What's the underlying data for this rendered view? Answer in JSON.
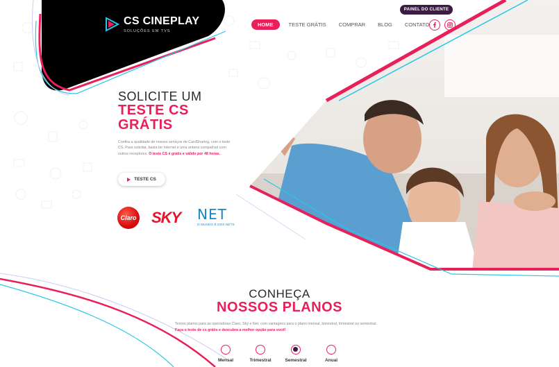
{
  "brand": {
    "name": "CS CINEPLAY",
    "tagline": "SOLUÇÕES EM TVS"
  },
  "header": {
    "client_button": "PAINEL DO CLIENTE",
    "nav": [
      "HOME",
      "TESTE GRÁTIS",
      "COMPRAR",
      "BLOG",
      "CONTATO"
    ],
    "active_nav": "HOME",
    "social": [
      "facebook-icon",
      "instagram-icon"
    ]
  },
  "hero": {
    "pre_title": "SOLICITE UM",
    "title_line1": "TESTE CS",
    "title_line2": "GRÁTIS",
    "description": "Confira a qualidade de nossos serviços de CardSharing, com o teste CS. Para solicitar, basta ter internet e uma antena compatível com outros receptores.",
    "description_highlight": "O teste CS é grátis e válido por 48 horas.",
    "button": "TESTE CS"
  },
  "operators": {
    "claro": "Claro",
    "sky": "SKY",
    "net": "NET",
    "net_tagline": "O MUNDO É DOS NETS"
  },
  "plans": {
    "pre_title": "CONHEÇA",
    "title": "NOSSOS PLANOS",
    "description": "Temos planos para as operadoras Claro, Sky e Net, com vantagens para o plano mensal, bimestral, trimestral ou semestral.",
    "description_highlight": "Faça o teste de cs grátis e descubra a melhor opção para você!",
    "periods": [
      "Mensal",
      "Trimestral",
      "Semestral",
      "Anual"
    ],
    "selected_period": "Semestral"
  },
  "colors": {
    "accent": "#e8205a",
    "dark": "#3c1c44",
    "cyan": "#29c6e8",
    "logo_bg": "#000000"
  }
}
